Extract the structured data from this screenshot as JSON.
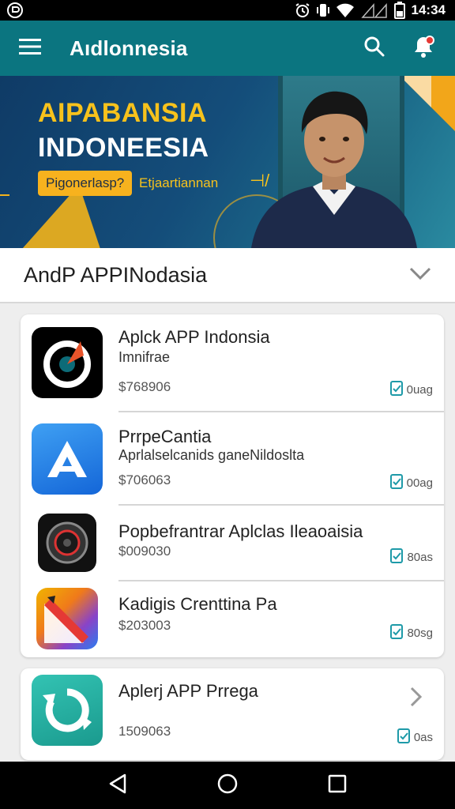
{
  "status_bar": {
    "time": "14:34",
    "icons": [
      "app-notification-icon",
      "alarm-icon",
      "vibrate-icon",
      "wifi-icon",
      "signal-icon",
      "battery-icon"
    ]
  },
  "app_bar": {
    "title": "Aıdlonnesia",
    "icons": [
      "menu-icon",
      "search-icon",
      "notification-icon"
    ],
    "color": "#0b7580"
  },
  "banner": {
    "title": "AIPABANSIA",
    "subtitle": "INDONEESIA",
    "button_label": "Pigonerlasp?",
    "caption": "Etjaartiannan",
    "decoration": "⊣/"
  },
  "section": {
    "title": "AndP APPINodasia",
    "icon": "chevron-down-icon"
  },
  "apps": [
    {
      "name": "Aplck APP Indonsia",
      "subtitle": "Imnifrae",
      "price": "$768906",
      "meta": "0uag",
      "icon": "target-icon"
    },
    {
      "name": "PrrpeCantia",
      "subtitle": "Aprlalselcanids ganeNildoslta",
      "price": "$706063",
      "meta": "00ag",
      "icon": "a-letter-icon"
    },
    {
      "name": "Popbefrantrar Aplclas Ileaoaisia",
      "subtitle": "",
      "price": "$009030",
      "meta": "80as",
      "icon": "camera-lens-icon"
    },
    {
      "name": "Kadigis Crenttina Pa",
      "subtitle": "",
      "price": "$203003",
      "meta": "80sg",
      "icon": "ruler-pencil-icon"
    },
    {
      "name": "Aplerj APP Prrega",
      "subtitle": "",
      "price": "1509063",
      "meta": "0as",
      "icon": "refresh-icon"
    }
  ],
  "nav_bar": {
    "icons": [
      "back-icon",
      "home-icon",
      "recents-icon"
    ]
  },
  "colors": {
    "accent": "#0b7580",
    "banner_yellow": "#f7c21c",
    "meta_icon": "#1e9aa8"
  }
}
